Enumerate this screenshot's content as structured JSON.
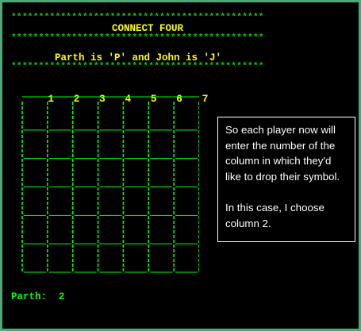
{
  "terminal": {
    "star_rule": "**********************************************",
    "title": "CONNECT FOUR",
    "players_line": "Parth is 'P' and John is 'J'",
    "columns": [
      "1",
      "2",
      "3",
      "4",
      "5",
      "6",
      "7"
    ],
    "rows": 6,
    "prompt_label": "Parth:",
    "prompt_value": "2"
  },
  "callout": {
    "paragraph_1": "So each player now will enter the number of the column in which they'd like to drop their symbol.",
    "paragraph_2": "In this case, I choose column 2."
  },
  "colors": {
    "background": "#000000",
    "frame": "#4fa877",
    "border_lines": "#00ff00",
    "heading_text": "#ffff00",
    "callout_text": "#ffffff"
  }
}
